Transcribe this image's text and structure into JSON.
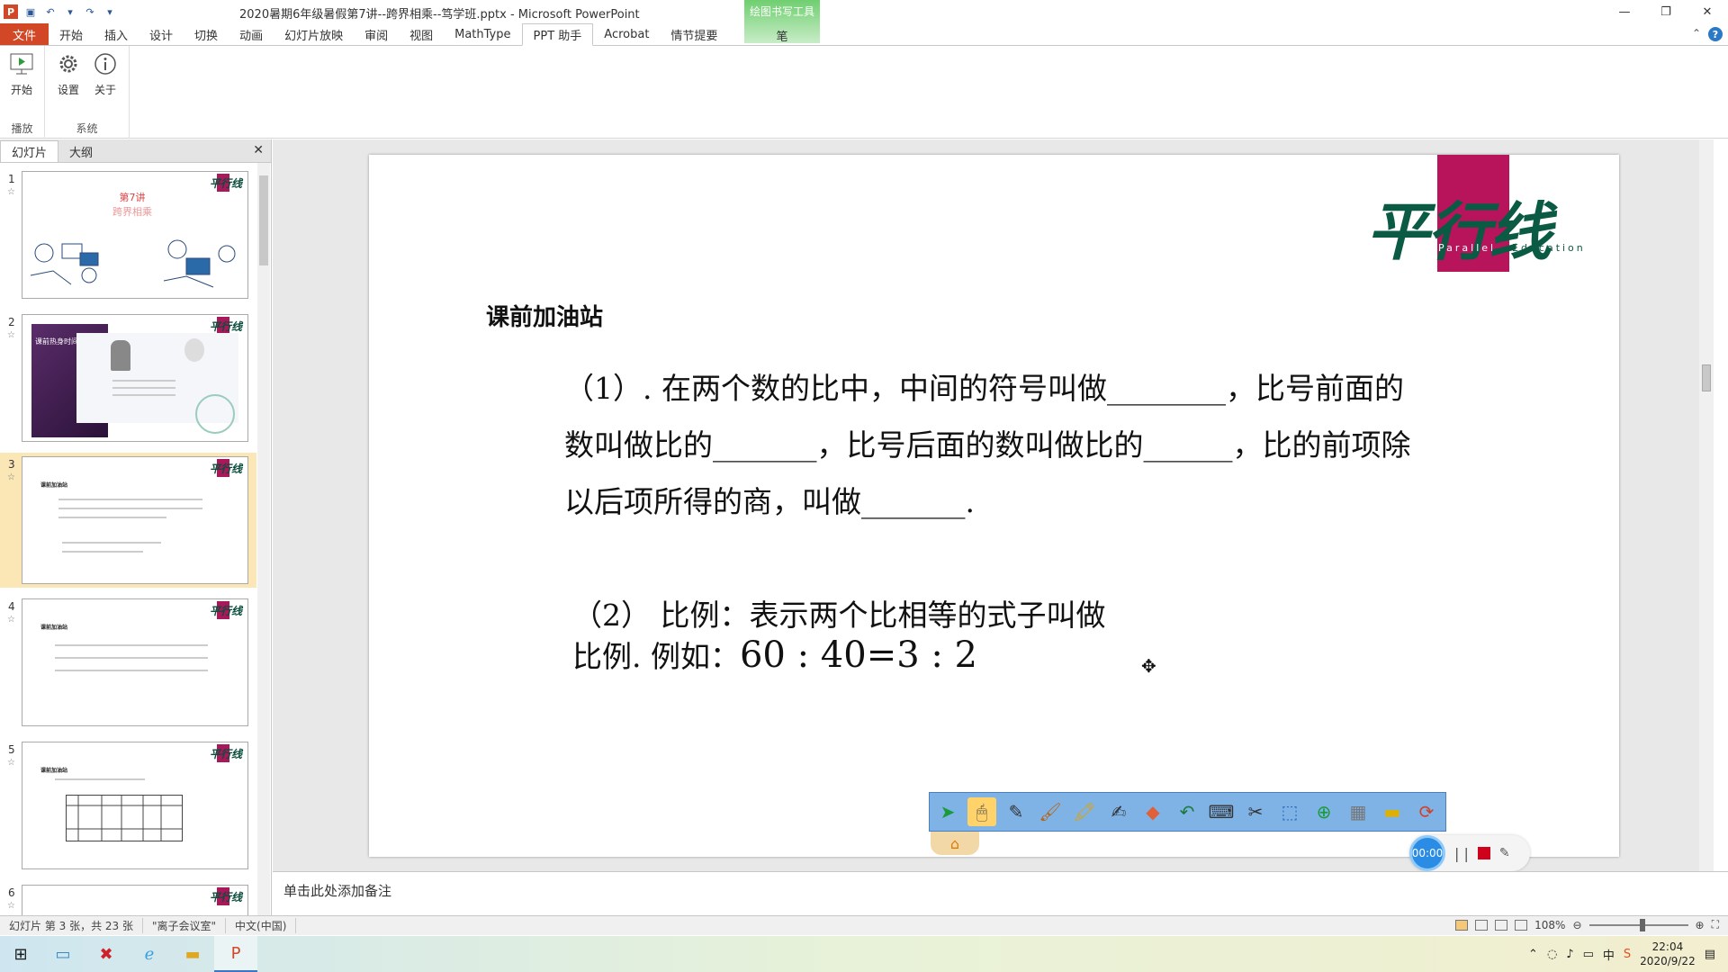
{
  "window": {
    "title": "2020暑期6年级暑假第7讲--跨界相乘--笃学班.pptx - Microsoft PowerPoint",
    "app_icon": "P",
    "context_tab_group": "绘图书写工具",
    "context_tab": "笔",
    "controls": [
      "—",
      "❐",
      "✕"
    ]
  },
  "ribbon": {
    "tabs": [
      "文件",
      "开始",
      "插入",
      "设计",
      "切换",
      "动画",
      "幻灯片放映",
      "审阅",
      "视图",
      "MathType",
      "PPT 助手",
      "Acrobat",
      "情节提要"
    ],
    "active_tab": "PPT 助手",
    "groups": [
      {
        "label": "播放",
        "buttons": [
          {
            "label": "开始",
            "icon": "play-icon"
          }
        ]
      },
      {
        "label": "系统",
        "buttons": [
          {
            "label": "设置",
            "icon": "gear-icon"
          },
          {
            "label": "关于",
            "icon": "info-icon"
          }
        ]
      }
    ]
  },
  "panel": {
    "tabs": [
      "幻灯片",
      "大纲"
    ],
    "active_tab": "幻灯片",
    "close": "✕",
    "thumbnails": [
      {
        "num": "1",
        "title": "第7讲",
        "subtitle": "跨界相乘"
      },
      {
        "num": "2",
        "title": "课前热身时间"
      },
      {
        "num": "3",
        "title": "课前加油站",
        "active": true
      },
      {
        "num": "4",
        "title": "课前加油站"
      },
      {
        "num": "5",
        "title": "课前加油站"
      },
      {
        "num": "6",
        "title": ""
      }
    ],
    "selected_index": 2
  },
  "slide": {
    "logo_text": "平行线",
    "logo_sub_a": "Parallel",
    "logo_sub_b": "Education",
    "heading": "课前加油站",
    "para1": "（1）. 在两个数的比中，中间的符号叫做________，比号前面的数叫做比的_______，比号后面的数叫做比的______，比的前项除以后项所得的商，叫做_______.",
    "para2_line1": "（2）  比例：表示两个比相等的式子叫做",
    "para2_line2_a": "比例. 例如：",
    "para2_line2_b": "60 : 40=3 : 2"
  },
  "pen_toolbar": {
    "tools": [
      "arrow-icon",
      "mouse-icon",
      "pen-icon",
      "brush-icon",
      "highlighter-icon",
      "text-pen-icon",
      "eraser-icon",
      "undo-icon",
      "keyboard-icon",
      "tools-icon",
      "screenshot-icon",
      "new-page-icon",
      "calculator-icon",
      "folder-icon",
      "refresh-icon"
    ],
    "selected_tool": "mouse-icon",
    "home": "⌂"
  },
  "recorder": {
    "time": "00:00",
    "pause": "| |"
  },
  "notes": {
    "placeholder": "单击此处添加备注"
  },
  "statusbar": {
    "slide_info": "幻灯片 第 3 张，共 23 张",
    "theme": "\"离子会议室\"",
    "language": "中文(中国)",
    "zoom": "108%",
    "zoom_level": 0.54
  },
  "taskbar": {
    "apps": [
      "file-explorer-icon",
      "xmind-icon",
      "ie-icon",
      "folder-icon",
      "powerpoint-icon"
    ],
    "active_app": "powerpoint-icon",
    "time": "22:04",
    "date": "2020/9/22"
  },
  "colors": {
    "file_tab": "#d24726",
    "brand_magenta": "#b8145c",
    "brand_green": "#0a5a44",
    "selected_thumb": "#fbe7b5",
    "pen_toolbar_bg": "#7fb3e6"
  }
}
